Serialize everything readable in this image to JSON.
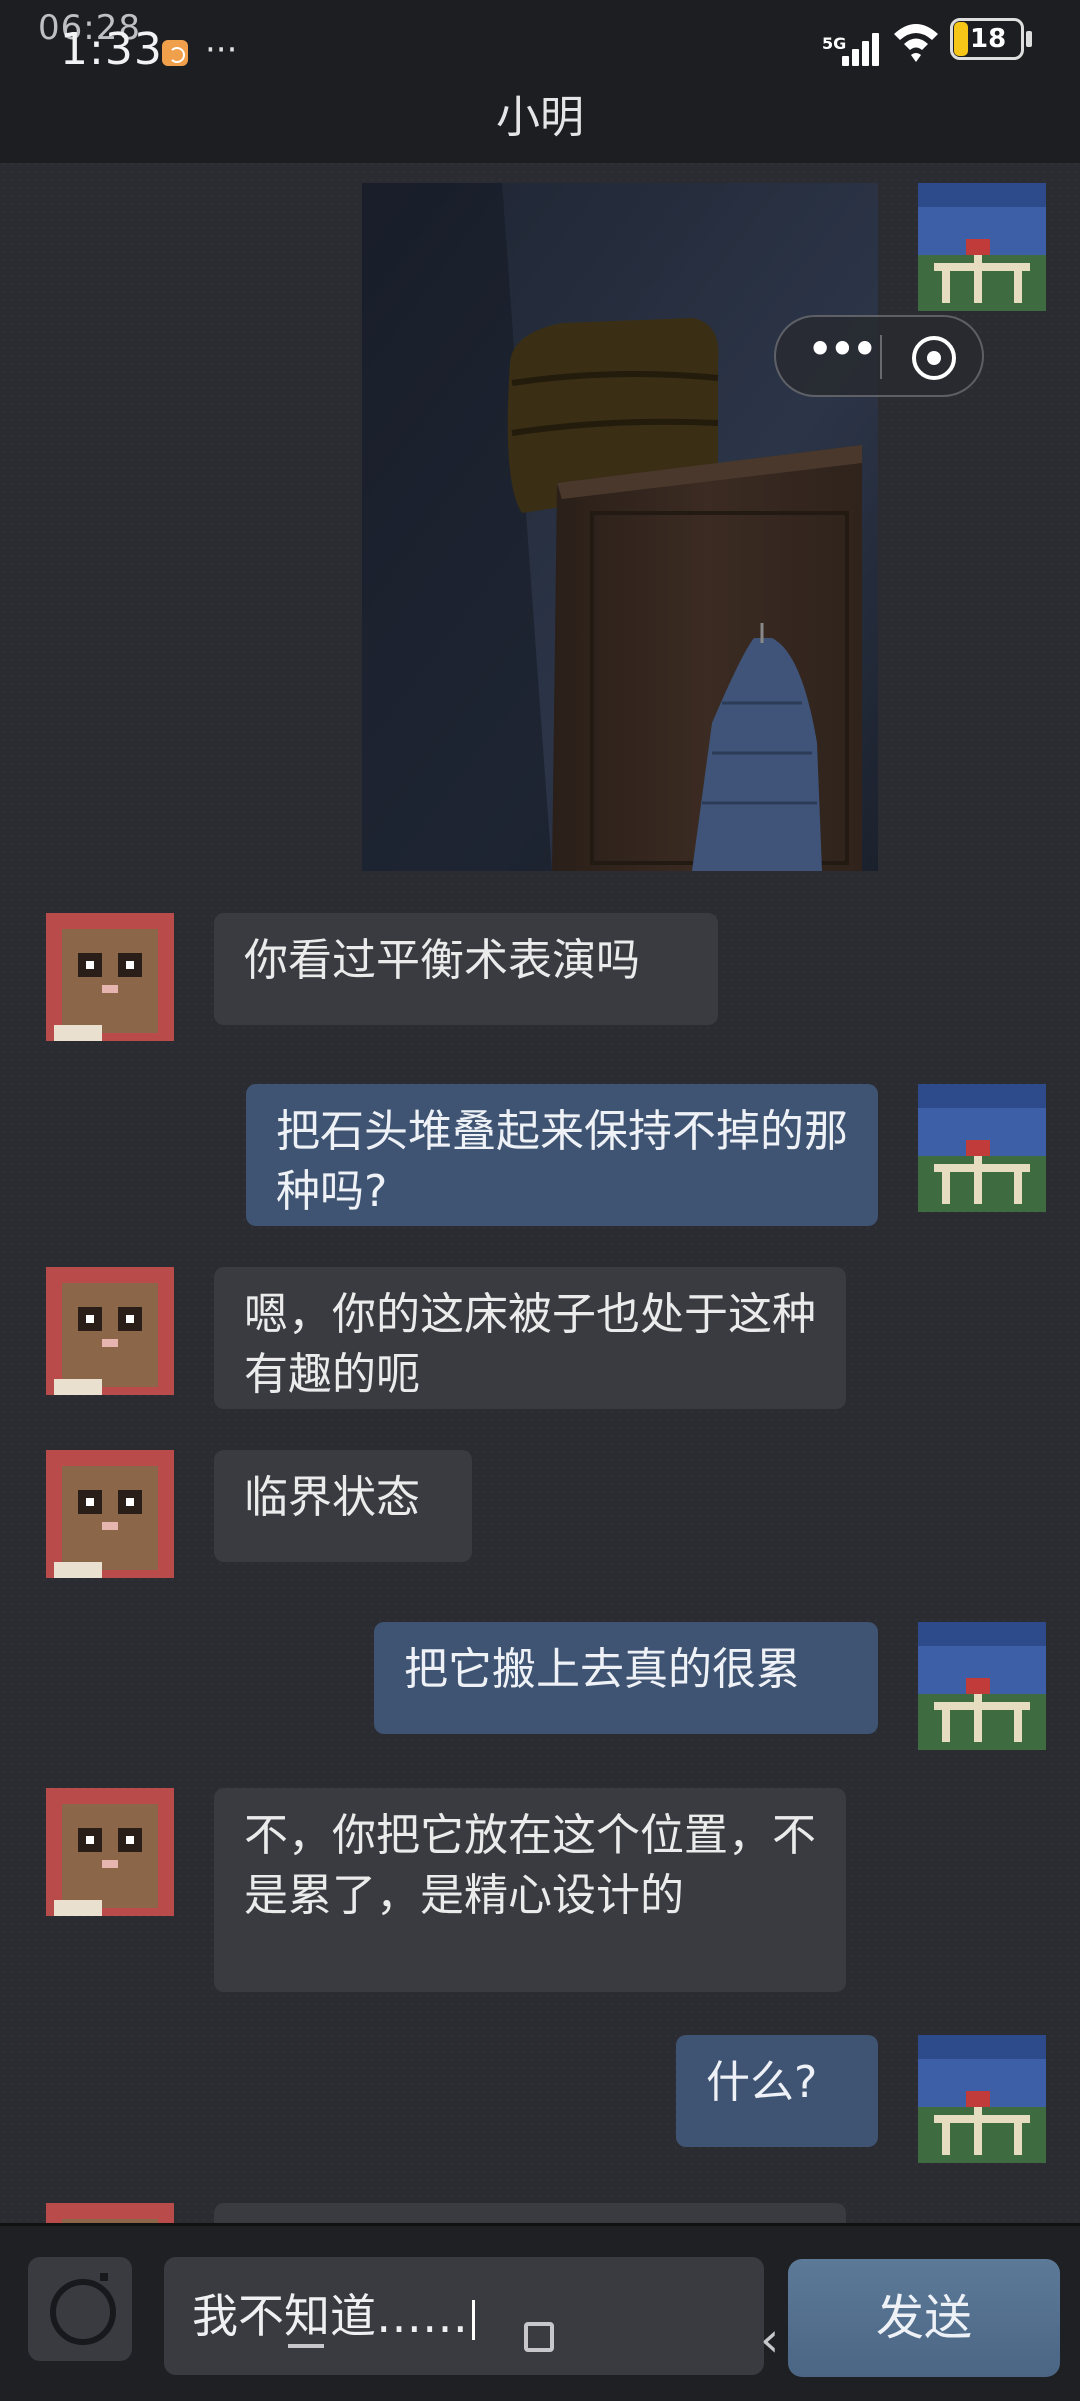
{
  "status_bar": {
    "time_overlay": "06:28",
    "time": "1:33",
    "more": "···",
    "network": "5G",
    "battery_level": "18"
  },
  "header": {
    "title": "小明"
  },
  "messages": [
    {
      "from": "other",
      "text": "你看过平衡术表演吗"
    },
    {
      "from": "me",
      "text": "把石头堆叠起来保持不掉的那种吗?"
    },
    {
      "from": "other",
      "text": "嗯，你的这床被子也处于这种有趣的呃"
    },
    {
      "from": "other",
      "text": "临界状态"
    },
    {
      "from": "me",
      "text": "把它搬上去真的很累"
    },
    {
      "from": "other",
      "text": "不，你把它放在这个位置，不是累了，是精心设计的"
    },
    {
      "from": "me",
      "text": "什么?"
    }
  ],
  "input": {
    "value": "我不知道……",
    "send_label": "发送"
  },
  "colors": {
    "bubble_other": "#3a3b40",
    "bubble_me": "#3f5372",
    "send_button": "#54708f",
    "background": "#2a2c31"
  }
}
